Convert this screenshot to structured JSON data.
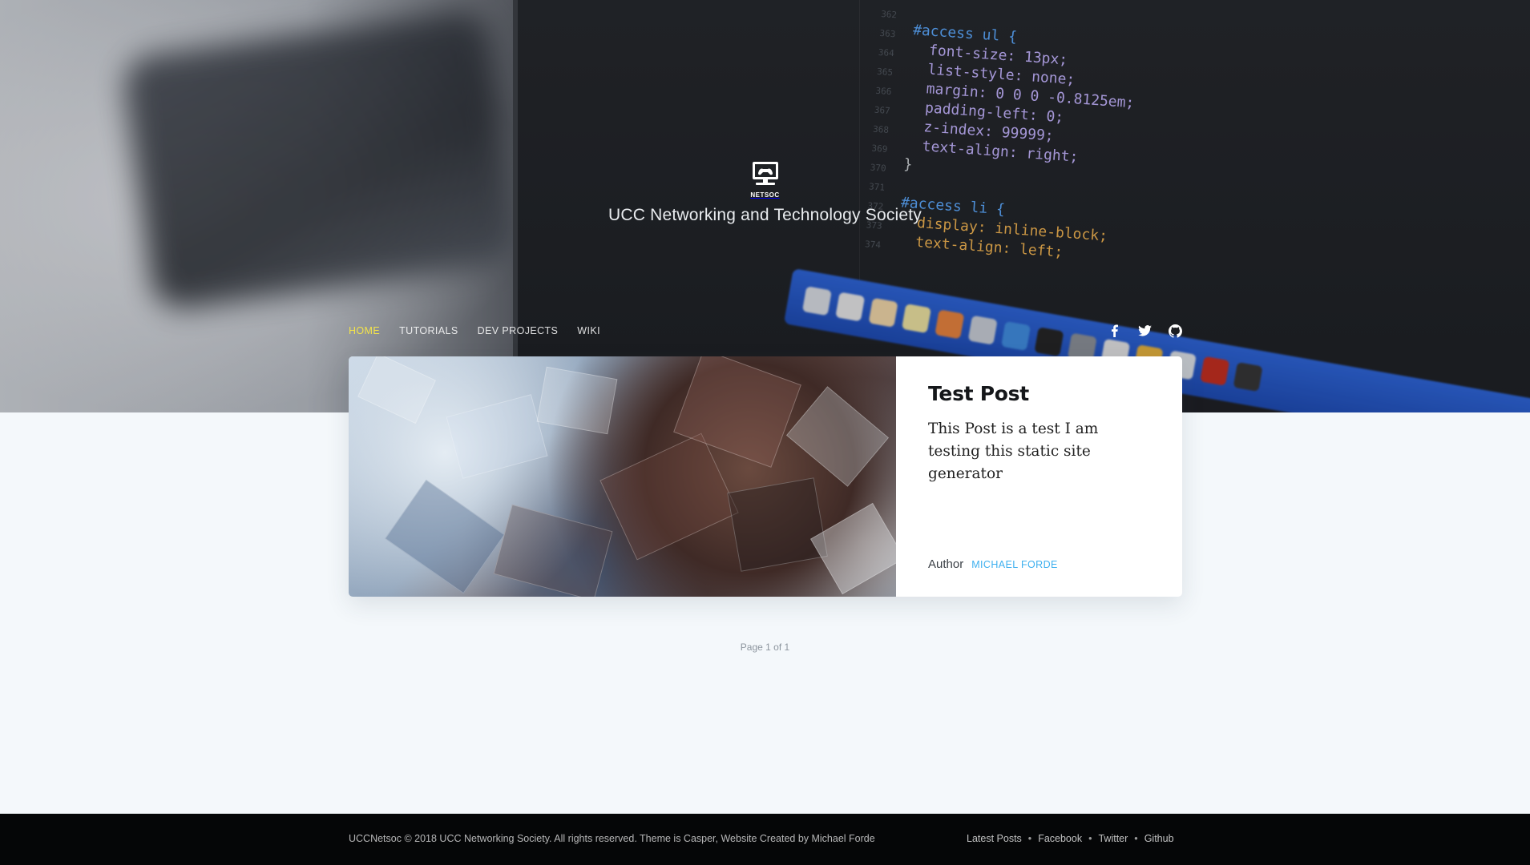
{
  "site": {
    "logo_text": "NETSOC",
    "description": "UCC Networking and Technology Society"
  },
  "nav": {
    "items": [
      {
        "label": "HOME",
        "active": true
      },
      {
        "label": "TUTORIALS",
        "active": false
      },
      {
        "label": "DEV PROJECTS",
        "active": false
      },
      {
        "label": "WIKI",
        "active": false
      }
    ],
    "social": [
      {
        "icon": "facebook-icon"
      },
      {
        "icon": "twitter-icon"
      },
      {
        "icon": "github-icon"
      }
    ]
  },
  "hero_code": {
    "line_numbers": "362\n363\n364\n365\n366\n367\n368\n369\n370\n371\n372\n373\n374",
    "lines": [
      {
        "text": "#access ul {"
      },
      {
        "text": "  font-size: 13px;"
      },
      {
        "text": "  list-style: none;"
      },
      {
        "text": "  margin: 0 0 0 -0.8125em;"
      },
      {
        "text": "  padding-left: 0;"
      },
      {
        "text": "  z-index: 99999;"
      },
      {
        "text": "  text-align: right;"
      },
      {
        "text": "}"
      },
      {
        "text": ""
      },
      {
        "text": "#access li {"
      },
      {
        "text": "  display: inline-block;"
      },
      {
        "text": "  text-align: left;"
      }
    ]
  },
  "post": {
    "title": "Test Post",
    "excerpt": "This Post is a test I am testing this static site generator",
    "author_label": "Author",
    "author_name": "MICHAEL FORDE"
  },
  "pagination": {
    "text": "Page 1 of 1"
  },
  "footer": {
    "copyright": "UCCNetsoc © 2018 UCC Networking Society. All rights reserved. Theme is Casper, Website Created by Michael Forde",
    "links": [
      "Latest Posts",
      "Facebook",
      "Twitter",
      "Github"
    ]
  },
  "colors": {
    "accent": "#3eb0ef",
    "nav_active": "#f3e34a",
    "page_bg": "#f4f8fb",
    "footer_bg": "#050607"
  }
}
